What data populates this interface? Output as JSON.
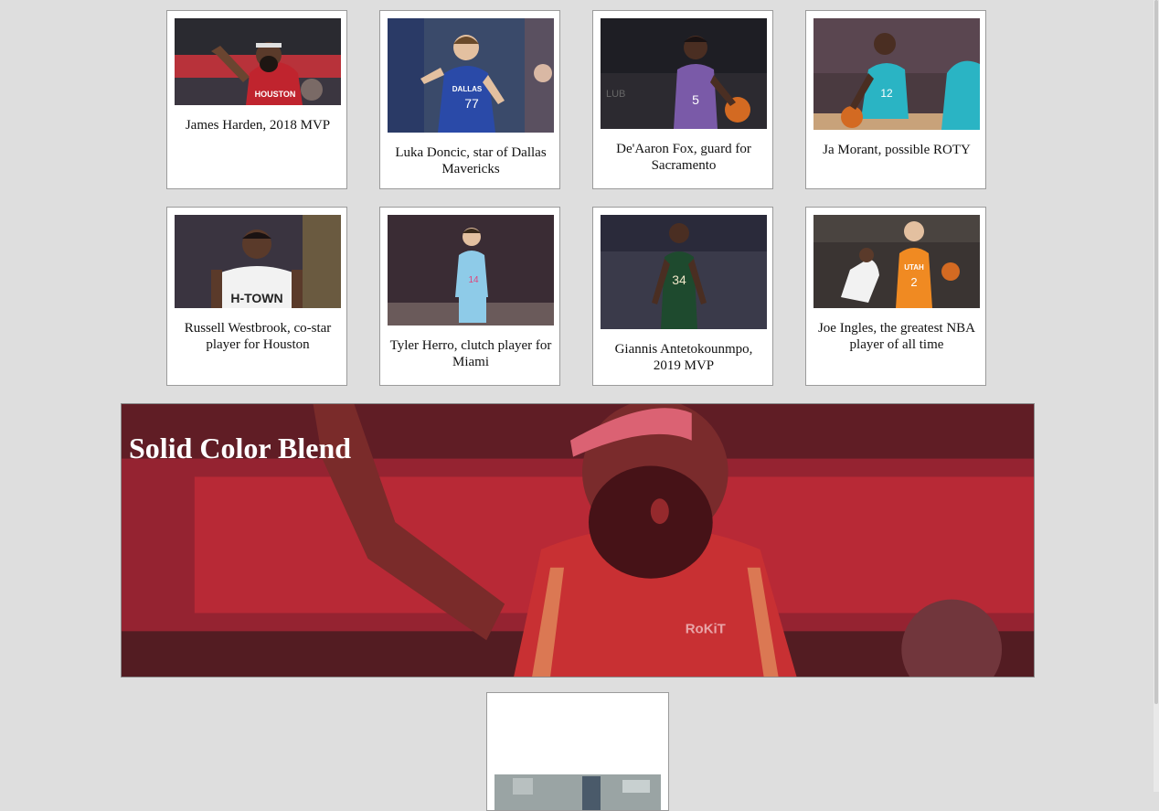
{
  "cards": [
    {
      "caption": "James Harden, 2018 MVP"
    },
    {
      "caption": "Luka Doncic, star of Dallas Mavericks"
    },
    {
      "caption": "De'Aaron Fox, guard for Sacramento"
    },
    {
      "caption": "Ja Morant, possible ROTY"
    },
    {
      "caption": "Russell Westbrook, co-star player for Houston"
    },
    {
      "caption": "Tyler Herro, clutch player for Miami"
    },
    {
      "caption": "Giannis Antetokounmpo, 2019 MVP"
    },
    {
      "caption": "Joe Ingles, the greatest NBA player of all time"
    }
  ],
  "blend": {
    "title": "Solid Color Blend",
    "jersey_text": "RoKiT",
    "overlay_color": "#c8283a"
  },
  "jerseys": {
    "harden": "HOUSTON",
    "doncic": "DALLAS",
    "doncic_number": "77",
    "fox_number": "5",
    "morant_number": "12",
    "westbrook": "H-TOWN",
    "herro_number": "14",
    "giannis_number": "34",
    "ingles": "UTAH",
    "ingles_number": "2"
  },
  "colors": {
    "page_bg": "#dedede",
    "card_bg": "#ffffff",
    "card_border": "#9b9b9b"
  }
}
